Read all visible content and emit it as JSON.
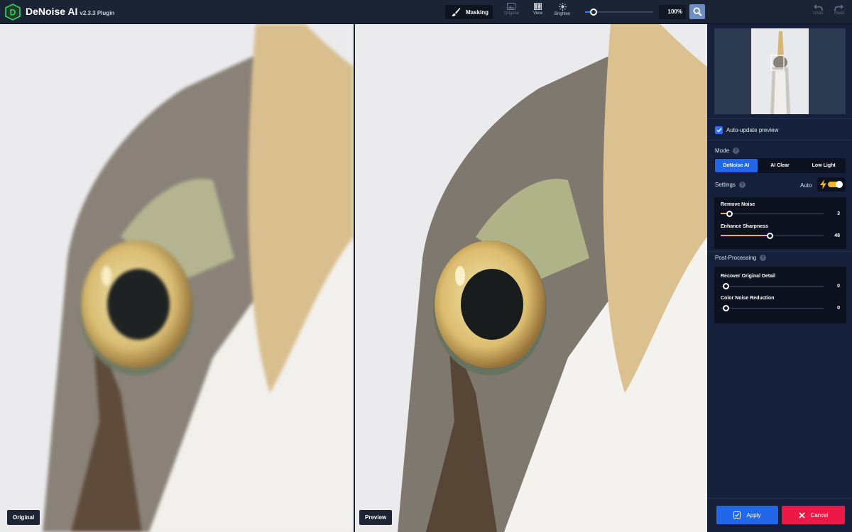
{
  "app": {
    "title": "DeNoise AI",
    "version": "v2.3.3 Plugin"
  },
  "toolbar": {
    "masking_label": "Masking",
    "original_label": "Original",
    "view_label": "View",
    "brighten_label": "Brighten",
    "zoom_value": "100%",
    "zoom_level_fraction": 0.1,
    "undo_label": "Undo",
    "redo_label": "Redo"
  },
  "canvas": {
    "left_label": "Original",
    "right_label": "Preview"
  },
  "panel": {
    "auto_update_label": "Auto-update preview",
    "auto_update_checked": true,
    "mode_label": "Mode",
    "mode_tabs": [
      "DeNoise AI",
      "AI Clear",
      "Low Light"
    ],
    "mode_active": "DeNoise AI",
    "settings_label": "Settings",
    "auto_label": "Auto",
    "sliders": [
      {
        "name": "Remove Noise",
        "value": "3",
        "fraction": 0.08
      },
      {
        "name": "Enhance Sharpness",
        "value": "48",
        "fraction": 0.48
      }
    ],
    "post_label": "Post-Processing",
    "post_sliders": [
      {
        "name": "Recover Original Detail",
        "value": "0",
        "fraction": 0
      },
      {
        "name": "Color Noise Reduction",
        "value": "0",
        "fraction": 0
      }
    ],
    "apply_label": "Apply",
    "cancel_label": "Cancel"
  },
  "colors": {
    "accent_blue": "#2167e8",
    "accent_yellow": "#f0b429",
    "cancel_red": "#ee1847",
    "panel_bg": "#16203a"
  }
}
